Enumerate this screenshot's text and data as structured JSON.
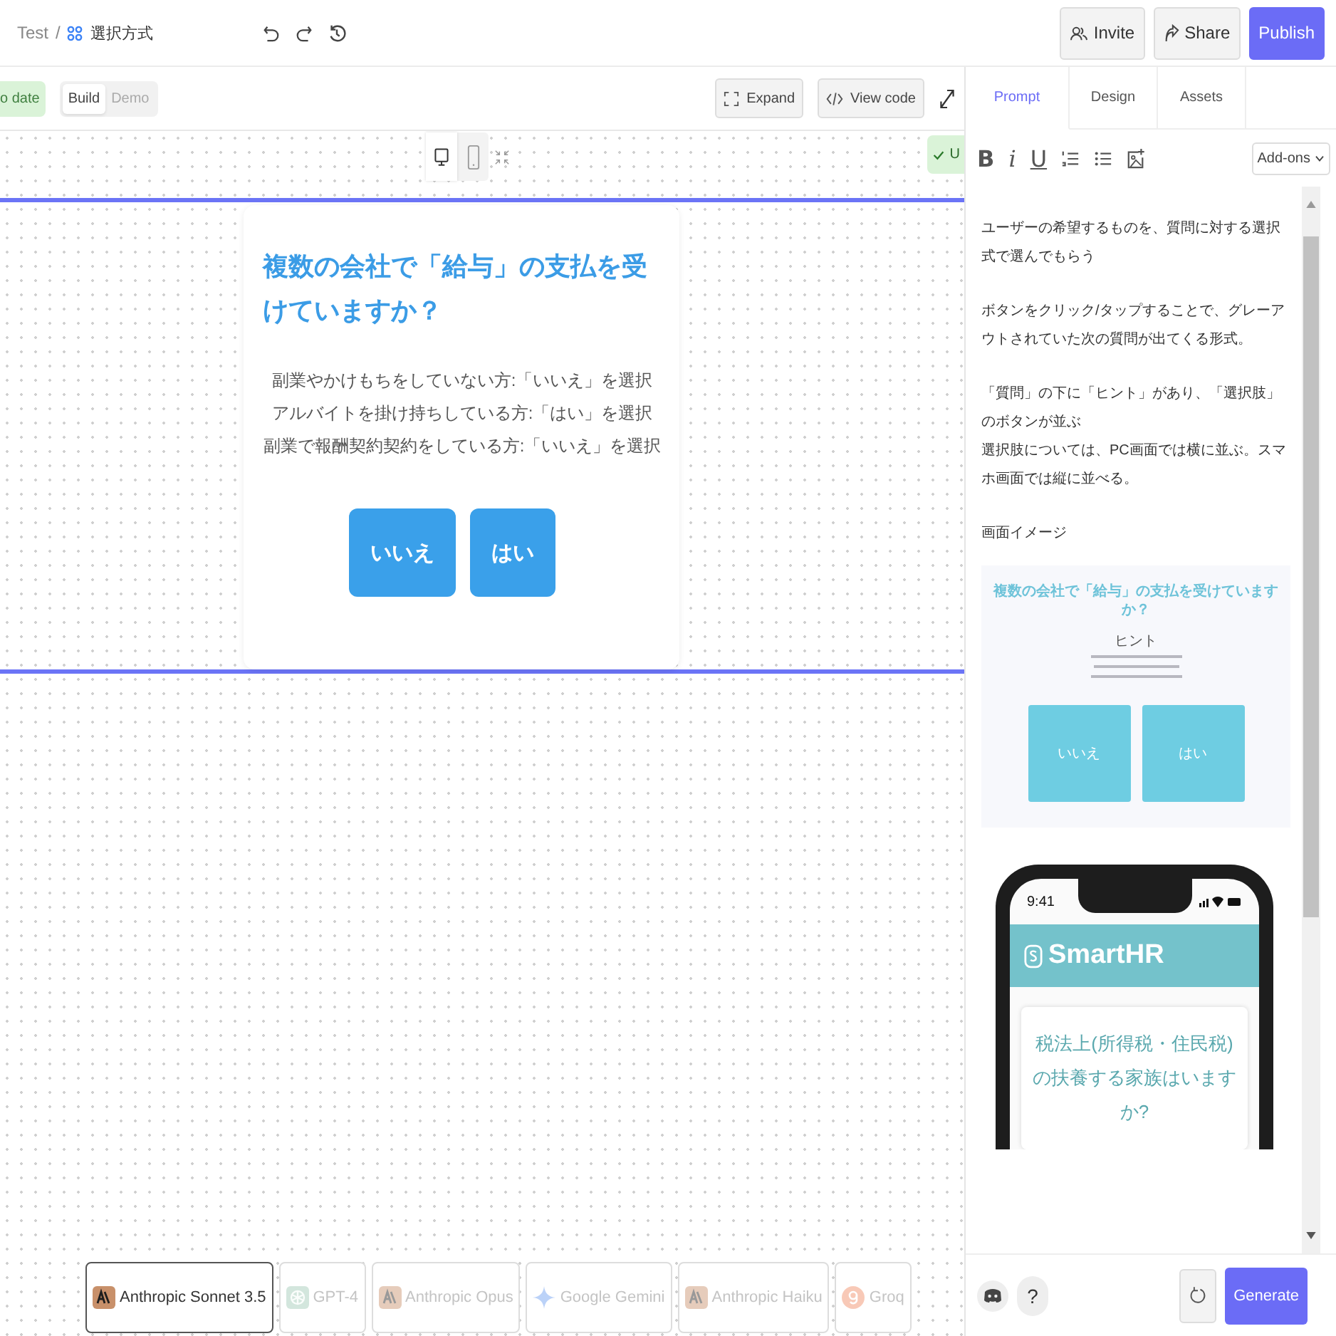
{
  "header": {
    "root": "Test",
    "separator": "/",
    "project": "選択方式",
    "buttons": [
      {
        "label": "Invite",
        "kind": "invite"
      },
      {
        "label": "Share",
        "kind": "share"
      },
      {
        "label": "Publish",
        "kind": "publish"
      }
    ]
  },
  "toolbar": {
    "status": "o date",
    "modes": [
      {
        "label": "Build",
        "selected": true
      },
      {
        "label": "Demo",
        "selected": false
      }
    ],
    "actions": [
      {
        "label": "Expand",
        "kind": "expand"
      },
      {
        "label": "View code",
        "kind": "code"
      }
    ]
  },
  "preview": {
    "devices": [
      {
        "kind": "desktop",
        "selected": true
      },
      {
        "kind": "mobile",
        "selected": false
      }
    ],
    "status": "U",
    "question": "複数の会社で「給与」の支払を受けていますか？",
    "hints": [
      "副業やかけもちをしていない方:「いいえ」を選択",
      "アルバイトを掛け持ちしている方:「はい」を選択",
      "副業で報酬契約契約をしている方:「いいえ」を選択"
    ],
    "answers": [
      "いいえ",
      "はい"
    ]
  },
  "models": [
    {
      "label": "Anthropic Sonnet 3.5",
      "kind": "anthropic",
      "selected": true
    },
    {
      "label": "GPT-4",
      "kind": "openai",
      "selected": false
    },
    {
      "label": "Anthropic Opus",
      "kind": "anthropic",
      "selected": false
    },
    {
      "label": "Google Gemini",
      "kind": "gemini",
      "selected": false
    },
    {
      "label": "Anthropic Haiku",
      "kind": "anthropic",
      "selected": false
    },
    {
      "label": "Groq",
      "kind": "groq",
      "selected": false
    }
  ],
  "panel": {
    "tabs": [
      {
        "label": "Prompt",
        "selected": true
      },
      {
        "label": "Design",
        "selected": false
      },
      {
        "label": "Assets",
        "selected": false
      }
    ],
    "format": {
      "bold": "B",
      "italic": "i",
      "underline": "U"
    },
    "addons": "Add-ons",
    "blocks": [
      [
        "ユーザーの希望するものを、質問に対する選択式で選んでもらう"
      ],
      [
        "ボタンをクリック/タップすることで、グレーアウトされていた次の質問が出てくる形式。"
      ],
      [
        "「質問」の下に「ヒント」があり、「選択肢」のボタンが並ぶ",
        "選択肢については、PC画面では横に並ぶ。スマホ画面では縦に並べる。"
      ],
      [
        "画面イメージ"
      ]
    ],
    "mockup": {
      "question": "複数の会社で「給与」の支払を受けていますか？",
      "hint_label": "ヒント",
      "answers": [
        "いいえ",
        "はい"
      ]
    },
    "phone": {
      "time": "9:41",
      "brand": "SmartHR",
      "question": "税法上(所得税・住民税)の扶養する家族はいますか?"
    },
    "help": "?",
    "generate": "Generate"
  }
}
